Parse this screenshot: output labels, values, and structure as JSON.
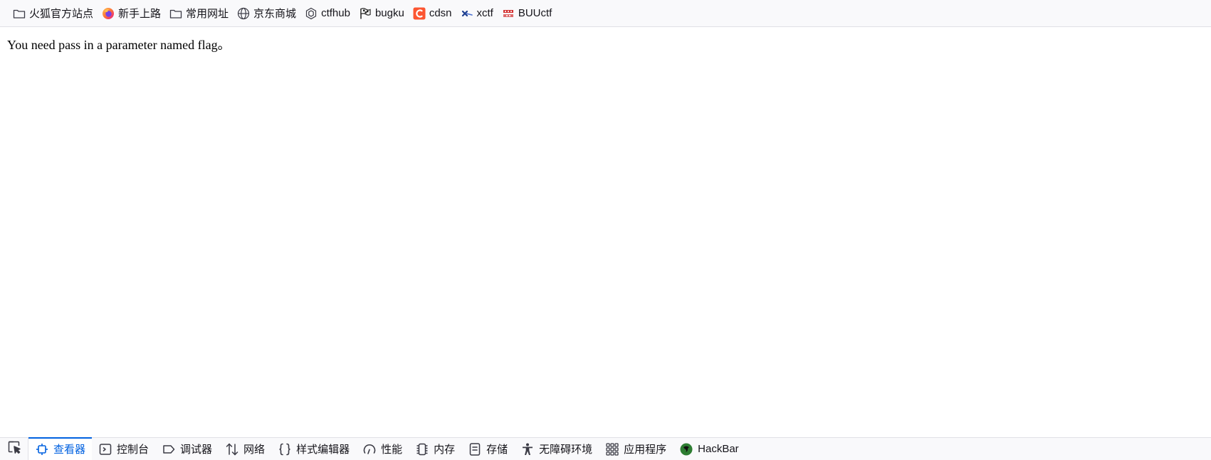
{
  "bookmarks": [
    {
      "label": "火狐官方站点",
      "icon": "folder-icon"
    },
    {
      "label": "新手上路",
      "icon": "firefox-icon"
    },
    {
      "label": "常用网址",
      "icon": "folder-icon"
    },
    {
      "label": "京东商城",
      "icon": "globe-icon"
    },
    {
      "label": "ctfhub",
      "icon": "ctfhub-icon"
    },
    {
      "label": "bugku",
      "icon": "flag-icon"
    },
    {
      "label": "cdsn",
      "icon": "csdn-icon"
    },
    {
      "label": "xctf",
      "icon": "xctf-icon"
    },
    {
      "label": "BUUctf",
      "icon": "buuctf-icon"
    }
  ],
  "page": {
    "text": "You need pass in a parameter named flag。"
  },
  "devtools": {
    "tabs": [
      {
        "label": "查看器",
        "icon": "inspector-icon",
        "selected": true
      },
      {
        "label": "控制台",
        "icon": "console-icon",
        "selected": false
      },
      {
        "label": "调试器",
        "icon": "debugger-icon",
        "selected": false
      },
      {
        "label": "网络",
        "icon": "network-icon",
        "selected": false
      },
      {
        "label": "样式编辑器",
        "icon": "style-editor-icon",
        "selected": false
      },
      {
        "label": "性能",
        "icon": "performance-icon",
        "selected": false
      },
      {
        "label": "内存",
        "icon": "memory-icon",
        "selected": false
      },
      {
        "label": "存储",
        "icon": "storage-icon",
        "selected": false
      },
      {
        "label": "无障碍环境",
        "icon": "accessibility-icon",
        "selected": false
      },
      {
        "label": "应用程序",
        "icon": "application-icon",
        "selected": false
      },
      {
        "label": "HackBar",
        "icon": "hackbar-icon",
        "selected": false
      }
    ]
  },
  "colors": {
    "accent": "#0061e0",
    "toolbar_bg": "#f9f9fb",
    "csdn": "#fc5531",
    "hackbar": "#2e7d32"
  }
}
